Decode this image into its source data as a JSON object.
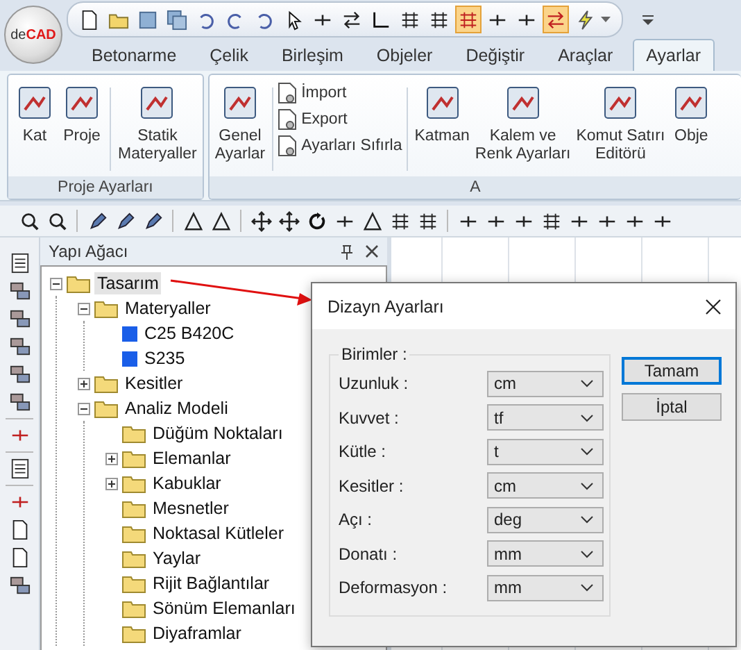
{
  "logo": {
    "prefix": "de",
    "name": "CAD"
  },
  "quick_access": [
    {
      "selected": false
    },
    {
      "selected": false
    },
    {
      "selected": false
    },
    {
      "selected": false
    },
    {
      "selected": false
    },
    {
      "selected": false
    },
    {
      "selected": false
    },
    {
      "selected": false
    },
    {
      "selected": false
    },
    {
      "selected": false
    },
    {
      "selected": false
    },
    {
      "selected": false
    },
    {
      "selected": false
    },
    {
      "selected": true
    },
    {
      "selected": false
    },
    {
      "selected": false
    },
    {
      "selected": true
    },
    {
      "selected": false
    }
  ],
  "tabs": [
    {
      "label": "Betonarme",
      "selected": false
    },
    {
      "label": "Çelik",
      "selected": false
    },
    {
      "label": "Birleşim",
      "selected": false
    },
    {
      "label": "Objeler",
      "selected": false
    },
    {
      "label": "Değiştir",
      "selected": false
    },
    {
      "label": "Araçlar",
      "selected": false
    },
    {
      "label": "Ayarlar",
      "selected": true
    }
  ],
  "ribbon": [
    {
      "label": "Proje Ayarları",
      "items": [
        {
          "kind": "large",
          "label": "Kat"
        },
        {
          "kind": "large",
          "label": "Proje"
        },
        {
          "kind": "separator"
        },
        {
          "kind": "large",
          "label": "Statik\nMateryaller"
        }
      ]
    },
    {
      "label": "A",
      "items": [
        {
          "kind": "large",
          "label": "Genel\nAyarlar"
        },
        {
          "kind": "separator"
        },
        {
          "kind": "stack",
          "buttons": [
            "İmport",
            "Export",
            "Ayarları Sıfırla"
          ]
        },
        {
          "kind": "separator"
        },
        {
          "kind": "large",
          "label": "Katman"
        },
        {
          "kind": "large",
          "label": "Kalem ve\nRenk Ayarları"
        },
        {
          "kind": "large",
          "label": "Komut Satırı\nEditörü"
        },
        {
          "kind": "large",
          "label": "Obje"
        }
      ]
    }
  ],
  "panel": {
    "title": "Yapı Ağacı"
  },
  "tree": [
    {
      "label": "Tasarım",
      "kind": "folder",
      "selected": true,
      "expanded": true,
      "children": [
        {
          "label": "Materyaller",
          "kind": "folder",
          "selected": false,
          "expanded": true,
          "children": [
            {
              "label": "C25 B420C",
              "kind": "material",
              "selected": false
            },
            {
              "label": "S235",
              "kind": "material",
              "selected": false
            }
          ]
        },
        {
          "label": "Kesitler",
          "kind": "folder",
          "selected": false,
          "expanded": false
        },
        {
          "label": "Analiz Modeli",
          "kind": "folder",
          "selected": false,
          "expanded": true,
          "children": [
            {
              "label": "Düğüm Noktaları",
              "kind": "folder",
              "selected": false
            },
            {
              "label": "Elemanlar",
              "kind": "folder",
              "selected": false,
              "expanded": false
            },
            {
              "label": "Kabuklar",
              "kind": "folder",
              "selected": false,
              "expanded": false
            },
            {
              "label": "Mesnetler",
              "kind": "folder",
              "selected": false
            },
            {
              "label": "Noktasal Kütleler",
              "kind": "folder",
              "selected": false
            },
            {
              "label": "Yaylar",
              "kind": "folder",
              "selected": false
            },
            {
              "label": "Rijit Bağlantılar",
              "kind": "folder",
              "selected": false
            },
            {
              "label": "Sönüm Elemanları",
              "kind": "folder",
              "selected": false
            },
            {
              "label": "Diyaframlar",
              "kind": "folder",
              "selected": false
            }
          ]
        }
      ]
    }
  ],
  "dialog": {
    "title": "Dizayn Ayarları",
    "group": "Birimler :",
    "fields": [
      {
        "label": "Uzunluk :",
        "value": "cm"
      },
      {
        "label": "Kuvvet :",
        "value": "tf"
      },
      {
        "label": "Kütle :",
        "value": "t"
      },
      {
        "label": "Kesitler :",
        "value": "cm"
      },
      {
        "label": "Açı :",
        "value": "deg"
      },
      {
        "label": "Donatı :",
        "value": "mm"
      },
      {
        "label": "Deformasyon :",
        "value": "mm"
      }
    ],
    "buttons": [
      {
        "label": "Tamam",
        "default": true
      },
      {
        "label": "İptal",
        "default": false
      }
    ]
  }
}
